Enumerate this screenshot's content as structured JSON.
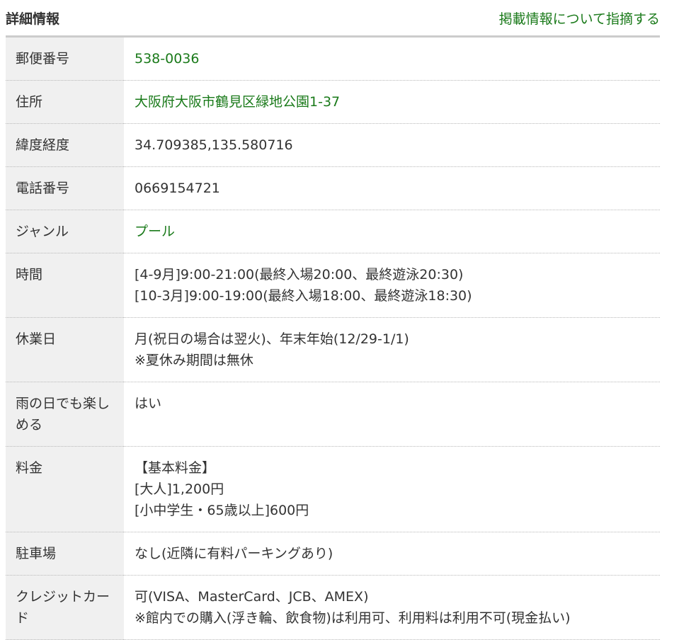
{
  "header": {
    "title": "詳細情報",
    "report_link": "掲載情報について指摘する"
  },
  "rows": [
    {
      "label": "郵便番号",
      "lines": [
        "538-0036"
      ]
    },
    {
      "label": "住所",
      "lines": [
        "大阪府大阪市鶴見区緑地公園1-37"
      ]
    },
    {
      "label": "緯度経度",
      "lines": [
        "34.709385,135.580716"
      ]
    },
    {
      "label": "電話番号",
      "lines": [
        "0669154721"
      ]
    },
    {
      "label": "ジャンル",
      "lines": [
        "プール"
      ]
    },
    {
      "label": "時間",
      "lines": [
        "[4-9月]9:00-21:00(最終入場20:00、最終遊泳20:30)",
        "[10-3月]9:00-19:00(最終入場18:00、最終遊泳18:30)"
      ]
    },
    {
      "label": "休業日",
      "lines": [
        "月(祝日の場合は翌火)、年末年始(12/29-1/1)",
        "※夏休み期間は無休"
      ]
    },
    {
      "label": "雨の日でも楽しめる",
      "lines": [
        "はい"
      ]
    },
    {
      "label": "料金",
      "lines": [
        "【基本料金】",
        "[大人]1,200円",
        "[小中学生・65歳以上]600円"
      ]
    },
    {
      "label": "駐車場",
      "lines": [
        "なし(近隣に有料パーキングあり)"
      ]
    },
    {
      "label": "クレジットカード",
      "lines": [
        "可(VISA、MasterCard、JCB、AMEX)",
        "※館内での購入(浮き輪、飲食物)は利用可、利用料は利用不可(現金払い)"
      ]
    }
  ]
}
